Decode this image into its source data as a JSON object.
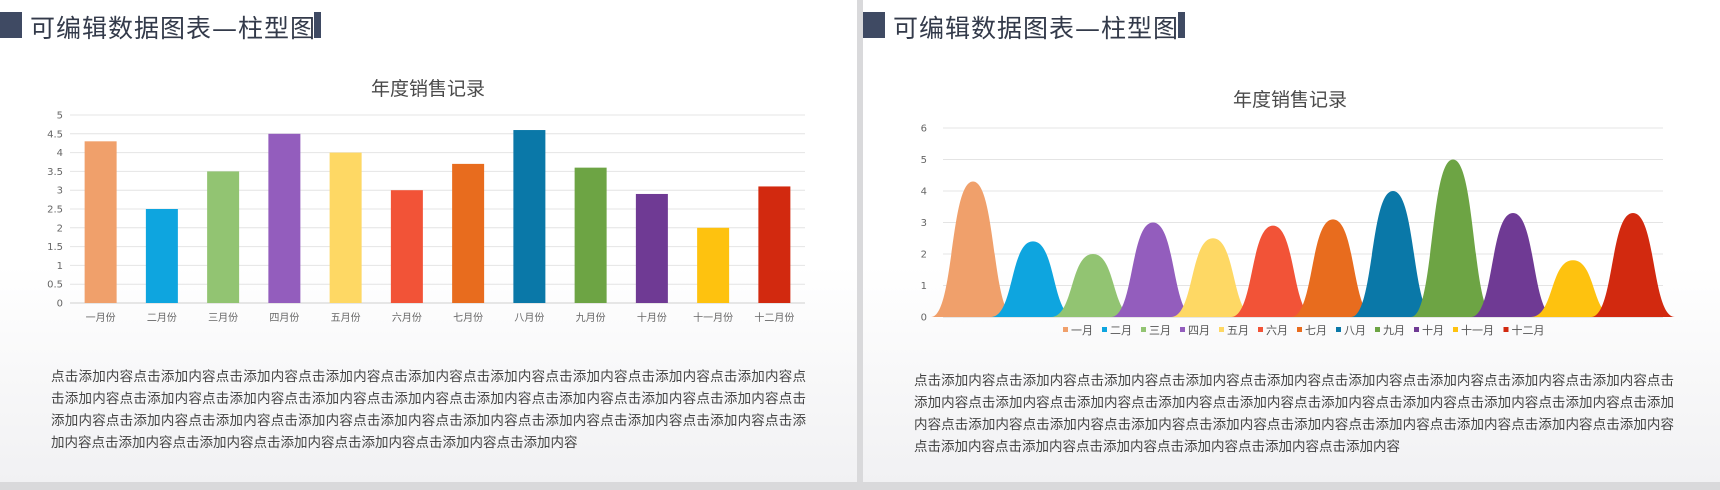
{
  "slides": [
    {
      "header": "可编辑数据图表—柱型图",
      "body_text": "点击添加内容点击添加内容点击添加内容点击添加内容点击添加内容点击添加内容点击添加内容点击添加内容点击添加内容点击添加内容点击添加内容点击添加内容点击添加内容点击添加内容点击添加内容点击添加内容点击添加内容点击添加内容点击添加内容点击添加内容点击添加内容点击添加内容点击添加内容点击添加内容点击添加内容点击添加内容点击添加内容点击添加内容点击添加内容点击添加内容点击添加内容点击添加内容点击添加内容点击添加内容"
    },
    {
      "header": "可编辑数据图表—柱型图",
      "body_text": "点击添加内容点击添加内容点击添加内容点击添加内容点击添加内容点击添加内容点击添加内容点击添加内容点击添加内容点击添加内容点击添加内容点击添加内容点击添加内容点击添加内容点击添加内容点击添加内容点击添加内容点击添加内容点击添加内容点击添加内容点击添加内容点击添加内容点击添加内容点击添加内容点击添加内容点击添加内容点击添加内容点击添加内容点击添加内容点击添加内容点击添加内容点击添加内容点击添加内容点击添加内容"
    }
  ],
  "chart_data": [
    {
      "type": "bar",
      "title": "年度销售记录",
      "categories": [
        "一月份",
        "二月份",
        "三月份",
        "四月份",
        "五月份",
        "六月份",
        "七月份",
        "八月份",
        "九月份",
        "十月份",
        "十一月份",
        "十二月份"
      ],
      "values": [
        4.3,
        2.5,
        3.5,
        4.5,
        4.0,
        3.0,
        3.7,
        4.6,
        3.6,
        2.9,
        2.0,
        3.1
      ],
      "colors": [
        "#f0a06b",
        "#0ea5df",
        "#92c472",
        "#935dbd",
        "#fed864",
        "#f25337",
        "#e86c1e",
        "#0a78a8",
        "#6da444",
        "#6f3a94",
        "#fec20f",
        "#d2290f"
      ],
      "ylim": [
        0,
        5
      ],
      "yticks": [
        "0",
        "0.5",
        "1",
        "1.5",
        "2",
        "2.5",
        "3",
        "3.5",
        "4",
        "4.5",
        "5"
      ],
      "grid": true,
      "xlabel": "",
      "ylabel": ""
    },
    {
      "type": "area",
      "title": "年度销售记录",
      "series": [
        {
          "name": "一月",
          "value": 4.3,
          "color": "#f0a06b"
        },
        {
          "name": "二月",
          "value": 2.4,
          "color": "#0ea5df"
        },
        {
          "name": "三月",
          "value": 2.0,
          "color": "#92c472"
        },
        {
          "name": "四月",
          "value": 3.0,
          "color": "#935dbd"
        },
        {
          "name": "五月",
          "value": 2.5,
          "color": "#fed864"
        },
        {
          "name": "六月",
          "value": 2.9,
          "color": "#f25337"
        },
        {
          "name": "七月",
          "value": 3.1,
          "color": "#e86c1e"
        },
        {
          "name": "八月",
          "value": 4.0,
          "color": "#0a78a8"
        },
        {
          "name": "九月",
          "value": 5.0,
          "color": "#6da444"
        },
        {
          "name": "十月",
          "value": 3.3,
          "color": "#6f3a94"
        },
        {
          "name": "十一月",
          "value": 1.8,
          "color": "#fec20f"
        },
        {
          "name": "十二月",
          "value": 3.3,
          "color": "#d2290f"
        }
      ],
      "ylim": [
        0,
        6
      ],
      "yticks": [
        "0",
        "1",
        "2",
        "3",
        "4",
        "5",
        "6"
      ],
      "grid": true,
      "legend": "bottom",
      "xlabel": "",
      "ylabel": ""
    }
  ]
}
